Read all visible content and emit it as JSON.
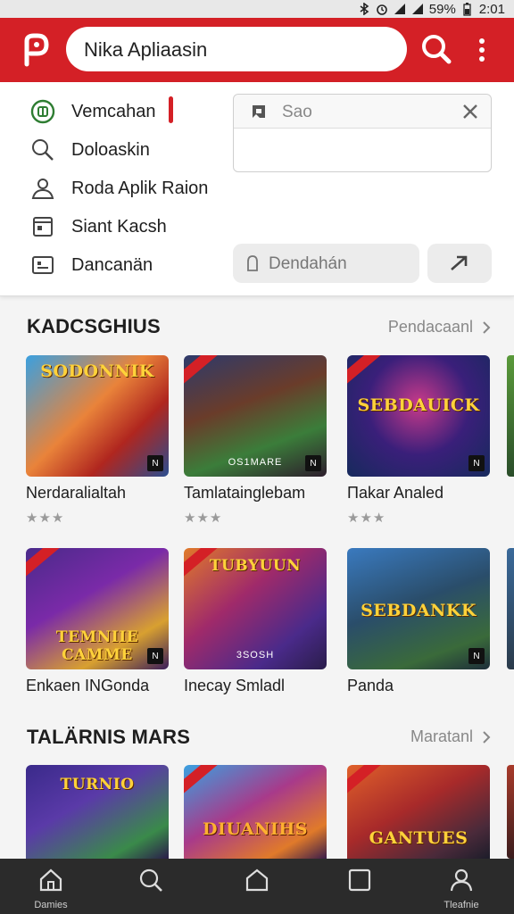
{
  "status_bar": {
    "battery": "59%",
    "time": "2:01"
  },
  "header": {
    "logo": "P",
    "search_value": "Nika Apliaasin",
    "search_icon": "search-icon",
    "menu_icon": "more-vertical-icon",
    "brand_color": "#d42026"
  },
  "dropdown": {
    "menu": [
      {
        "label": "Vemcahan",
        "icon": "circle-home-icon",
        "active": true
      },
      {
        "label": "Doloaskin",
        "icon": "search-icon"
      },
      {
        "label": "Roda Aplik Raion",
        "icon": "person-icon"
      },
      {
        "label": "Siant Kacsh",
        "icon": "calendar-icon"
      },
      {
        "label": "Dancanän",
        "icon": "image-card-icon"
      }
    ],
    "filter_placeholder": "Sao",
    "secondary_button": "Dendahán"
  },
  "sections": [
    {
      "title": "KADCSGHIUS",
      "more": "Pendacaanl",
      "cards": [
        {
          "title": "Nerdaralialtah",
          "caption": "SODONNIK",
          "rating": "★★★"
        },
        {
          "title": "Tamlatainglebam",
          "caption": "",
          "sub": "OS1MARE",
          "rating": "★★★"
        },
        {
          "title": "Πakar Analed",
          "caption": "SEBDAUICK",
          "rating": "★★★"
        }
      ]
    },
    {
      "title": "",
      "cards": [
        {
          "title": "Enkaen INGonda",
          "caption": "TEMNIIE CAMME"
        },
        {
          "title": "Inecay Smladl",
          "caption": "TUBYUUN",
          "sub": "3SOSH"
        },
        {
          "title": "Panda",
          "caption": "SEBDANKK"
        }
      ]
    },
    {
      "title": "TALÄRNIS MARS",
      "more": "Maratanl",
      "cards": [
        {
          "caption": "TURNIO"
        },
        {
          "caption": "DIUANIHS"
        },
        {
          "caption": "GANTUES"
        }
      ]
    }
  ],
  "bottom_nav": [
    {
      "label": "Damies",
      "icon": "home-icon"
    },
    {
      "label": "",
      "icon": "search-icon"
    },
    {
      "label": "",
      "icon": "home-outline-icon"
    },
    {
      "label": "",
      "icon": "square-icon"
    },
    {
      "label": "Tleafnie",
      "icon": "profile-icon"
    }
  ]
}
